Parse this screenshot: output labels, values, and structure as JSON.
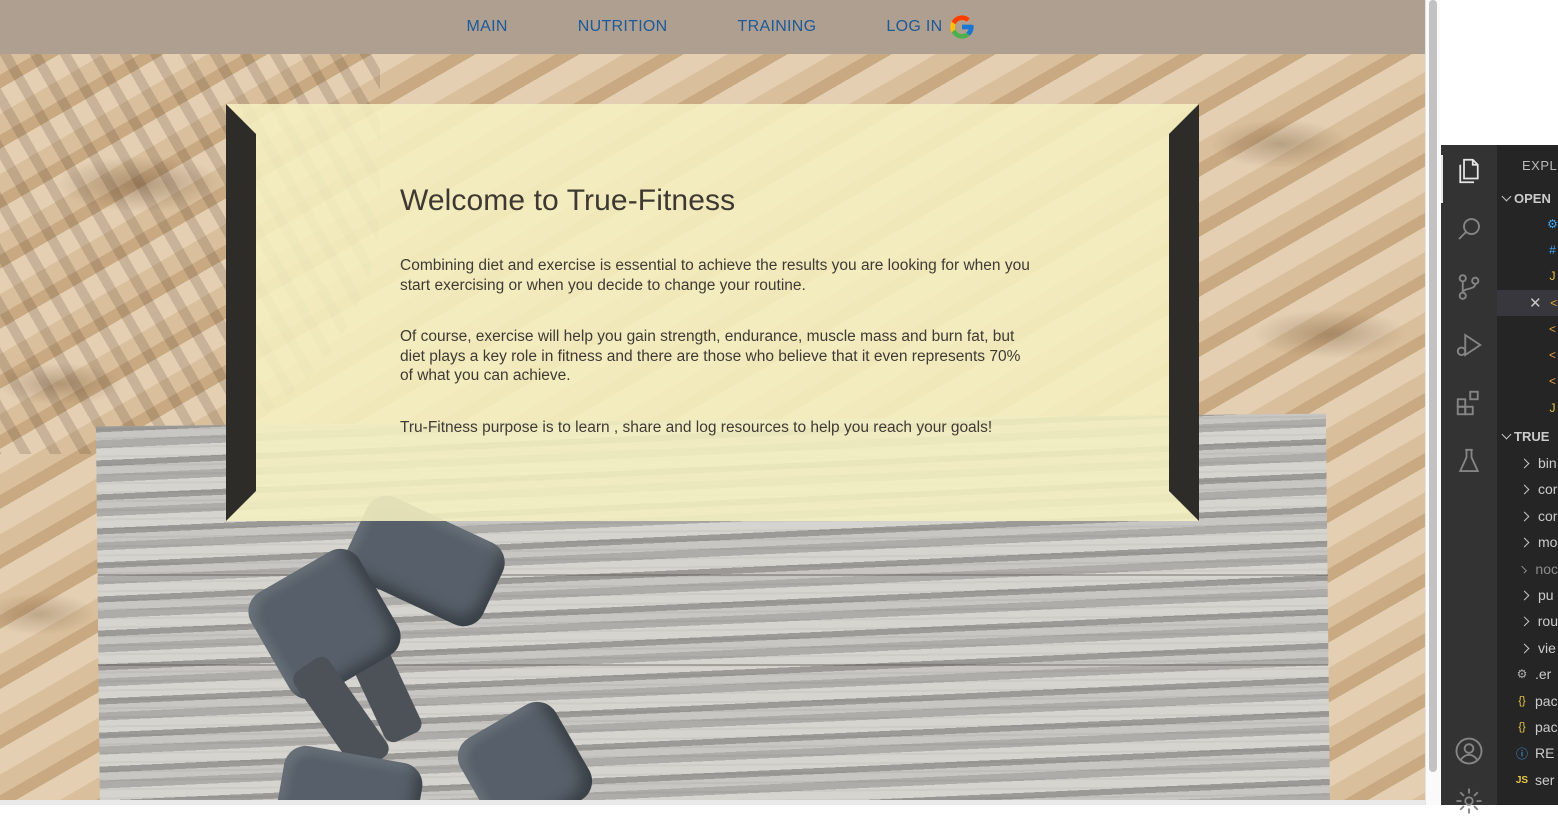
{
  "nav": {
    "items": [
      "MAIN",
      "NUTRITION",
      "TRAINING"
    ],
    "login_label": "LOG IN",
    "login_icon": "google-g-icon",
    "link_color": "#1d5a97",
    "bar_color": "#ae9f91"
  },
  "hero": {
    "title": "Welcome to True-Fitness",
    "paragraphs": [
      "Combining diet and exercise is essential to achieve the results you are looking for when you start exercising or when you decide to change your routine.",
      "Of course, exercise will help you gain strength, endurance, muscle mass and burn fat, but diet plays a key role in fitness and there are those who believe that it even represents 70% of what you can achieve.",
      "Tru-Fitness purpose is to learn , share and log resources to help you reach your goals!"
    ],
    "card_color": "#f5f0c0"
  },
  "vscode": {
    "explorer_title": "EXPLO",
    "open_editors_label": "OPEN",
    "project_label": "TRUE",
    "open_editor_icons": [
      "gear-file-icon",
      "gear-file-icon",
      "js-file-icon",
      "html-file-icon",
      "html-file-icon",
      "html-file-icon",
      "html-file-icon",
      "js-file-icon"
    ],
    "folders": [
      "bin",
      "cor",
      "cor",
      "mo",
      "noc",
      "pu",
      "rou",
      "vie"
    ],
    "files": [
      {
        "icon": "gear-icon",
        "name": ".er"
      },
      {
        "icon": "json-icon",
        "name": "pac"
      },
      {
        "icon": "json-icon",
        "name": "pac"
      },
      {
        "icon": "info-icon",
        "name": "RE"
      },
      {
        "icon": "js-icon",
        "name": "ser"
      }
    ],
    "activity_icons": [
      "files-icon",
      "search-icon",
      "source-control-icon",
      "run-debug-icon",
      "extensions-icon",
      "testing-icon",
      "account-icon",
      "settings-gear-icon"
    ]
  }
}
